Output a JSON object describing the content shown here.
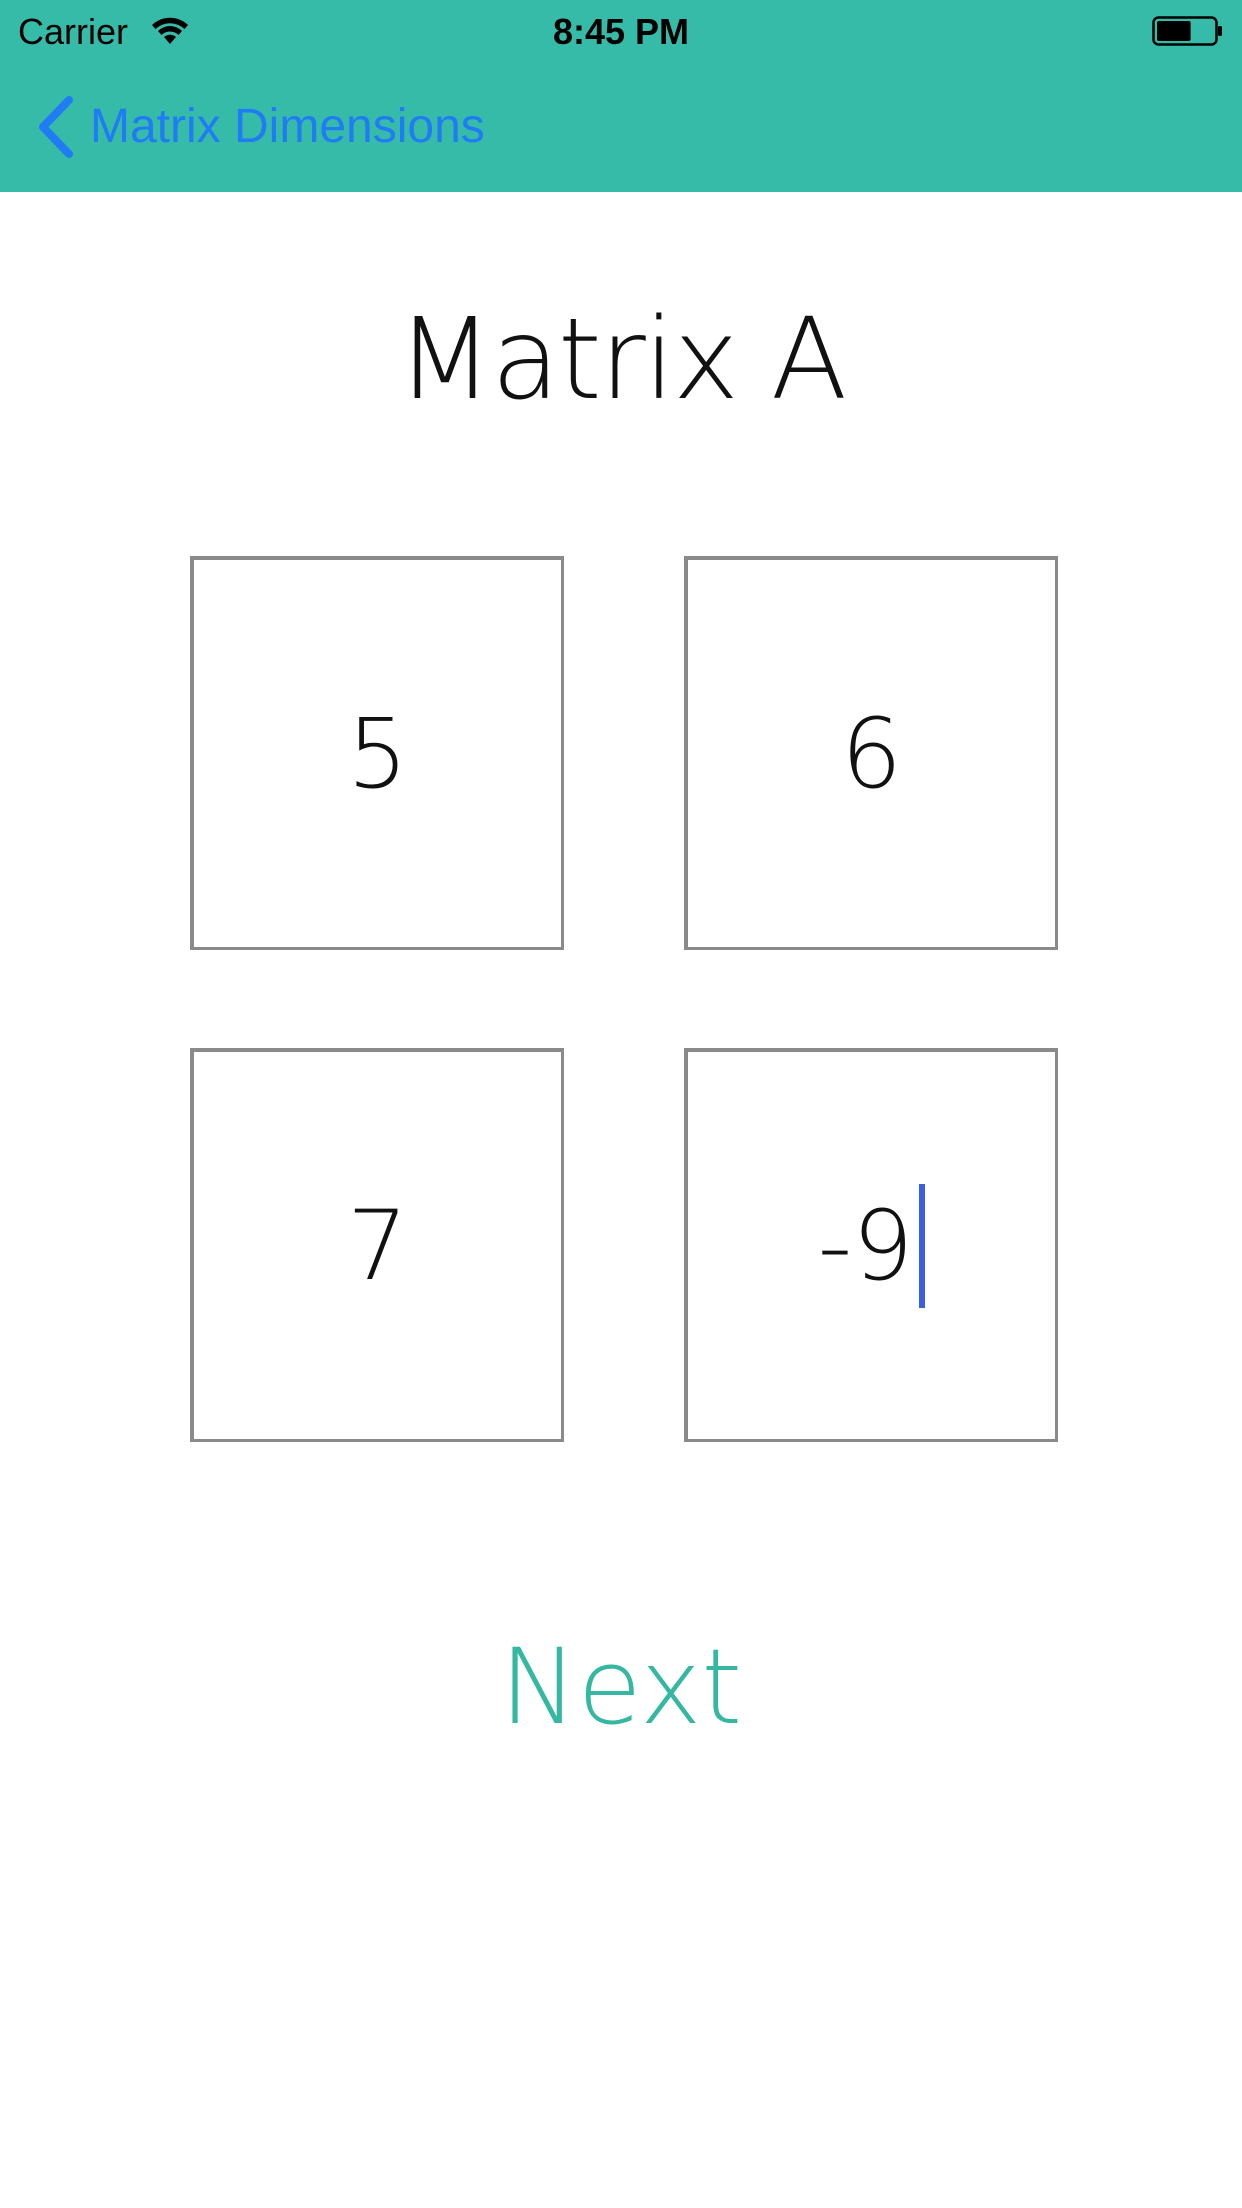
{
  "status_bar": {
    "carrier": "Carrier",
    "time": "8:45 PM",
    "battery_level": 0.6
  },
  "nav": {
    "back_label": "Matrix Dimensions",
    "bar_color": "#37bba9",
    "tint_color": "#1f7cf5"
  },
  "screen": {
    "title": "Matrix A",
    "matrix": {
      "rows": [
        [
          "5",
          "6"
        ],
        [
          "7",
          "-9"
        ]
      ],
      "focused_cell": "row 2, column 2"
    },
    "next_label": "Next",
    "accent_color": "#35b7a1"
  }
}
